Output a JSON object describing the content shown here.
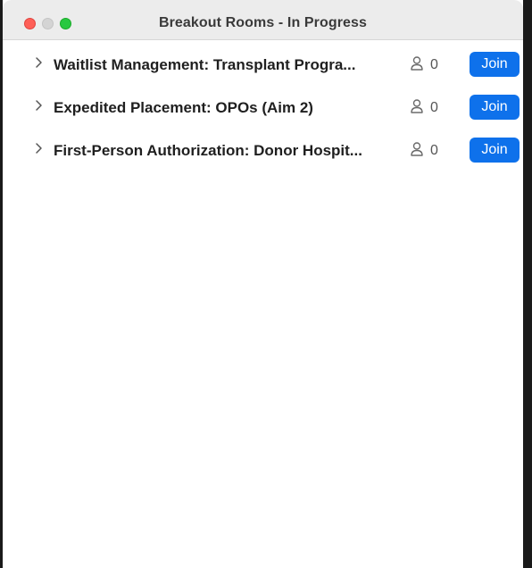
{
  "window": {
    "title": "Breakout Rooms - In Progress"
  },
  "colors": {
    "close": "#fe5f57",
    "minimize": "#d4d4d4",
    "zoom": "#28c840",
    "join_button": "#0e71eb"
  },
  "rooms": [
    {
      "name": "Waitlist Management: Transplant Progra...",
      "participants": "0",
      "join_label": "Join",
      "icon": "chevron-right-icon"
    },
    {
      "name": "Expedited Placement: OPOs (Aim 2)",
      "participants": "0",
      "join_label": "Join",
      "icon": "chevron-right-icon"
    },
    {
      "name": "First-Person Authorization: Donor Hospit...",
      "participants": "0",
      "join_label": "Join",
      "icon": "chevron-right-icon"
    }
  ]
}
